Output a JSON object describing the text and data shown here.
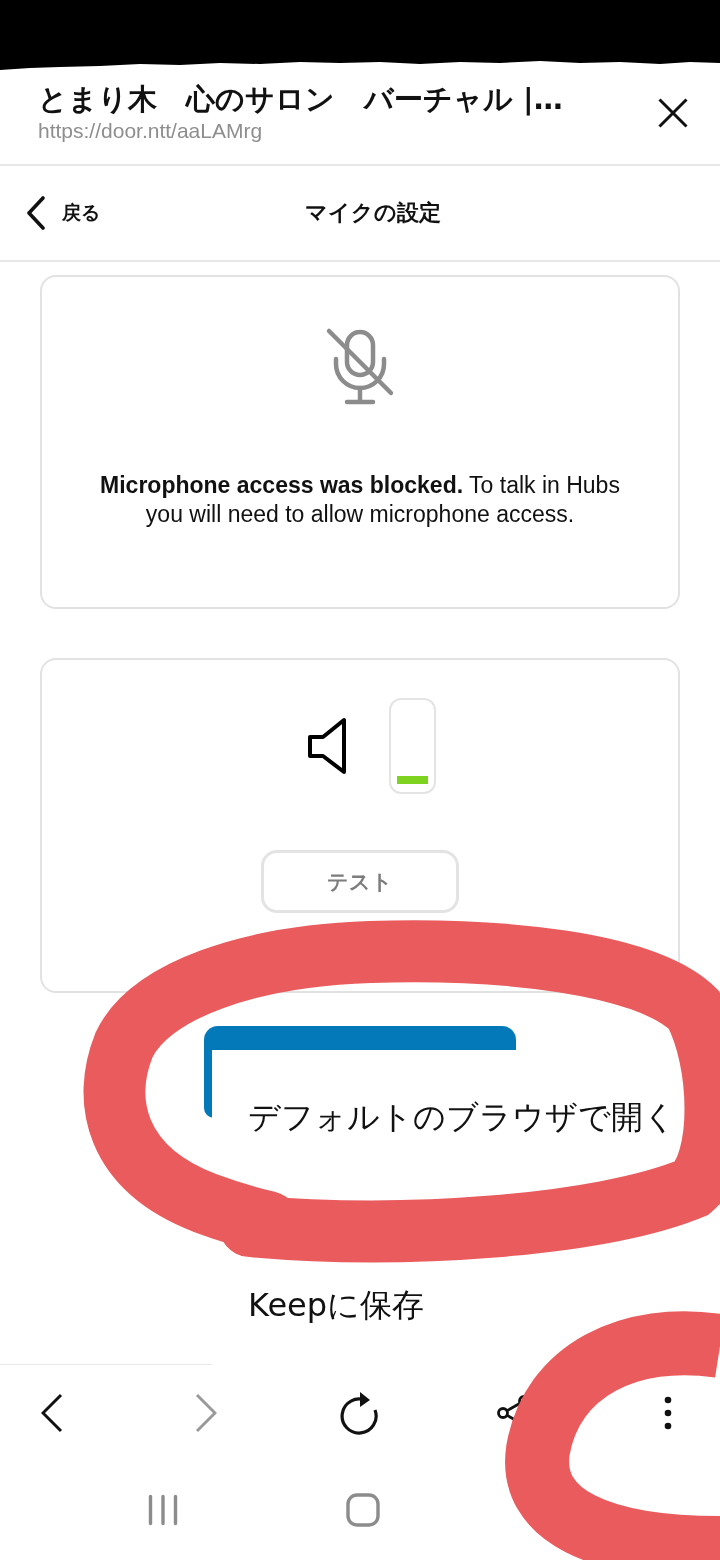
{
  "browser_header": {
    "title": "とまり木　心のサロン　バーチャル |…",
    "url": "https://door.ntt/aaLAMrg"
  },
  "nav_bar": {
    "back_label": "戻る",
    "title": "マイクの設定"
  },
  "mic_card": {
    "message": "**Microphone access was blocked.** To talk in Hubs you will need to allow microphone access."
  },
  "speaker_card": {
    "level": 0.1,
    "test_button": "テスト"
  },
  "menu": {
    "items": [
      {
        "label": "デフォルトのブラウザで開く"
      },
      {
        "label": "Keepに保存"
      }
    ]
  },
  "toolbar": [
    {
      "kind": "back",
      "disabled": false
    },
    {
      "kind": "forward",
      "disabled": true
    },
    {
      "kind": "reload",
      "disabled": false
    },
    {
      "kind": "share",
      "disabled": false
    },
    {
      "kind": "more",
      "disabled": false
    }
  ]
}
